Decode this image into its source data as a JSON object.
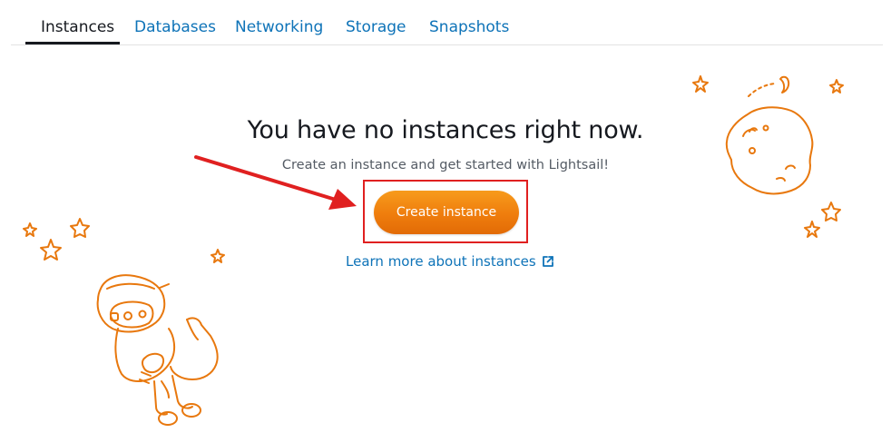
{
  "tabs": [
    {
      "label": "Instances",
      "active": true
    },
    {
      "label": "Databases",
      "active": false
    },
    {
      "label": "Networking",
      "active": false
    },
    {
      "label": "Storage",
      "active": false
    },
    {
      "label": "Snapshots",
      "active": false
    }
  ],
  "empty_state": {
    "headline": "You have no instances right now.",
    "subline": "Create an instance and get started with Lightsail!",
    "create_button_label": "Create instance",
    "learn_more_label": "Learn more about instances"
  },
  "annotation": {
    "arrow_color": "#e02020",
    "highlight_color": "#e02020"
  },
  "colors": {
    "accent_orange": "#ec7211",
    "link_blue": "#0e73b8",
    "illustration_orange": "#e8780e"
  },
  "icons": {
    "external_link": "external-link-icon"
  }
}
